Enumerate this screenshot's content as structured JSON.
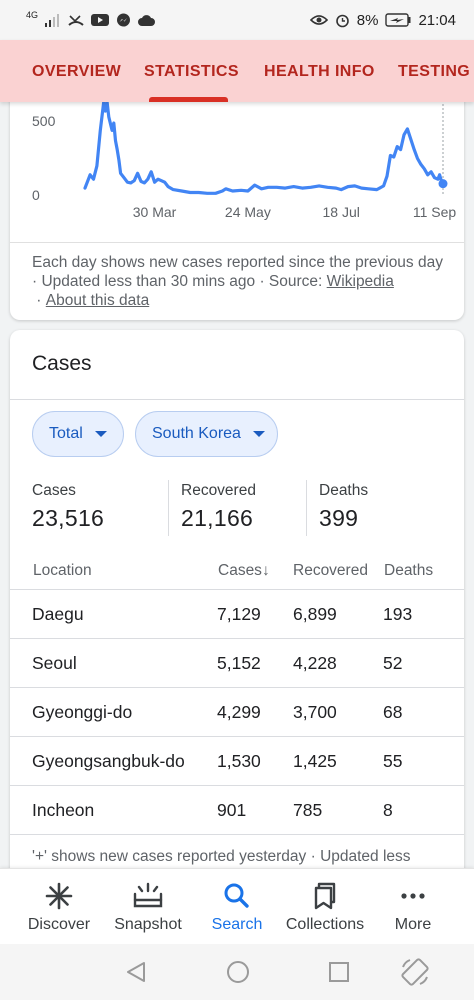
{
  "status_bar": {
    "network": "4G",
    "battery": "8%",
    "time": "21:04"
  },
  "tabs": [
    {
      "label": "OVERVIEW",
      "active": false
    },
    {
      "label": "STATISTICS",
      "active": true
    },
    {
      "label": "HEALTH INFO",
      "active": false
    },
    {
      "label": "TESTING",
      "active": false
    }
  ],
  "chart": {
    "y_ticks": [
      "500",
      "0"
    ],
    "x_ticks": [
      "30 Mar",
      "24 May",
      "18 Jul",
      "11 Sep"
    ],
    "line_color": "#4285f4",
    "note_text": "Each day shows new cases reported since the previous day · Updated less than 30 mins ago · Source: ",
    "source_link": "Wikipedia",
    "about_link": "About this data"
  },
  "chart_data": {
    "type": "line",
    "title": "",
    "xlabel": "",
    "ylabel": "",
    "x_tick_labels": [
      "30 Mar",
      "24 May",
      "18 Jul",
      "11 Sep"
    ],
    "ylim": [
      0,
      600
    ],
    "x_range": [
      "2020-02-18",
      "2020-09-16"
    ],
    "series": [
      {
        "name": "",
        "points": [
          [
            "2020-02-18",
            40
          ],
          [
            "2020-02-21",
            130
          ],
          [
            "2020-02-23",
            100
          ],
          [
            "2020-02-25",
            190
          ],
          [
            "2020-02-27",
            430
          ],
          [
            "2020-02-29",
            620
          ],
          [
            "2020-03-01",
            560
          ],
          [
            "2020-03-02",
            620
          ],
          [
            "2020-03-03",
            520
          ],
          [
            "2020-03-05",
            430
          ],
          [
            "2020-03-06",
            480
          ],
          [
            "2020-03-07",
            360
          ],
          [
            "2020-03-08",
            300
          ],
          [
            "2020-03-09",
            230
          ],
          [
            "2020-03-10",
            140
          ],
          [
            "2020-03-12",
            110
          ],
          [
            "2020-03-14",
            80
          ],
          [
            "2020-03-16",
            75
          ],
          [
            "2020-03-18",
            90
          ],
          [
            "2020-03-20",
            140
          ],
          [
            "2020-03-22",
            85
          ],
          [
            "2020-03-24",
            75
          ],
          [
            "2020-03-26",
            100
          ],
          [
            "2020-03-28",
            150
          ],
          [
            "2020-03-30",
            80
          ],
          [
            "2020-04-01",
            100
          ],
          [
            "2020-04-03",
            90
          ],
          [
            "2020-04-05",
            80
          ],
          [
            "2020-04-07",
            50
          ],
          [
            "2020-04-10",
            30
          ],
          [
            "2020-04-15",
            20
          ],
          [
            "2020-04-20",
            10
          ],
          [
            "2020-04-25",
            10
          ],
          [
            "2020-04-30",
            5
          ],
          [
            "2020-05-05",
            5
          ],
          [
            "2020-05-09",
            20
          ],
          [
            "2020-05-11",
            35
          ],
          [
            "2020-05-15",
            20
          ],
          [
            "2020-05-20",
            25
          ],
          [
            "2020-05-24",
            20
          ],
          [
            "2020-05-28",
            60
          ],
          [
            "2020-06-01",
            35
          ],
          [
            "2020-06-05",
            45
          ],
          [
            "2020-06-10",
            45
          ],
          [
            "2020-06-15",
            40
          ],
          [
            "2020-06-20",
            50
          ],
          [
            "2020-06-25",
            40
          ],
          [
            "2020-06-30",
            45
          ],
          [
            "2020-07-05",
            55
          ],
          [
            "2020-07-10",
            45
          ],
          [
            "2020-07-15",
            40
          ],
          [
            "2020-07-18",
            30
          ],
          [
            "2020-07-22",
            50
          ],
          [
            "2020-07-26",
            55
          ],
          [
            "2020-07-30",
            40
          ],
          [
            "2020-08-03",
            35
          ],
          [
            "2020-08-08",
            30
          ],
          [
            "2020-08-12",
            55
          ],
          [
            "2020-08-14",
            120
          ],
          [
            "2020-08-16",
            260
          ],
          [
            "2020-08-18",
            250
          ],
          [
            "2020-08-20",
            320
          ],
          [
            "2020-08-22",
            300
          ],
          [
            "2020-08-24",
            400
          ],
          [
            "2020-08-26",
            440
          ],
          [
            "2020-08-28",
            370
          ],
          [
            "2020-08-30",
            300
          ],
          [
            "2020-09-01",
            240
          ],
          [
            "2020-09-03",
            200
          ],
          [
            "2020-09-05",
            170
          ],
          [
            "2020-09-07",
            130
          ],
          [
            "2020-09-09",
            150
          ],
          [
            "2020-09-11",
            110
          ],
          [
            "2020-09-13",
            100
          ],
          [
            "2020-09-14",
            130
          ],
          [
            "2020-09-15",
            90
          ],
          [
            "2020-09-16",
            70
          ]
        ]
      }
    ]
  },
  "cases_card": {
    "title": "Cases",
    "chip_filter": "Total",
    "chip_region": "South Korea",
    "summary": [
      {
        "label": "Cases",
        "value": "23,516"
      },
      {
        "label": "Recovered",
        "value": "21,166"
      },
      {
        "label": "Deaths",
        "value": "399"
      }
    ],
    "columns": [
      "Location",
      "Cases",
      "Recovered",
      "Deaths"
    ],
    "sort_indicator": "↓",
    "rows": [
      {
        "location": "Daegu",
        "cases": "7,129",
        "recovered": "6,899",
        "deaths": "193"
      },
      {
        "location": "Seoul",
        "cases": "5,152",
        "recovered": "4,228",
        "deaths": "52"
      },
      {
        "location": "Gyeonggi-do",
        "cases": "4,299",
        "recovered": "3,700",
        "deaths": "68"
      },
      {
        "location": "Gyeongsangbuk-do",
        "cases": "1,530",
        "recovered": "1,425",
        "deaths": "55"
      },
      {
        "location": "Incheon",
        "cases": "901",
        "recovered": "785",
        "deaths": "8"
      }
    ],
    "footnote": "'+' shows new cases reported yesterday · Updated less"
  },
  "bottom_nav": {
    "active_color": "#1a73e8",
    "items": [
      {
        "label": "Discover",
        "icon": "asterisk-icon",
        "active": false
      },
      {
        "label": "Snapshot",
        "icon": "snapshot-icon",
        "active": false
      },
      {
        "label": "Search",
        "icon": "search-icon",
        "active": true
      },
      {
        "label": "Collections",
        "icon": "collections-icon",
        "active": false
      },
      {
        "label": "More",
        "icon": "more-dots-icon",
        "active": false
      }
    ]
  }
}
